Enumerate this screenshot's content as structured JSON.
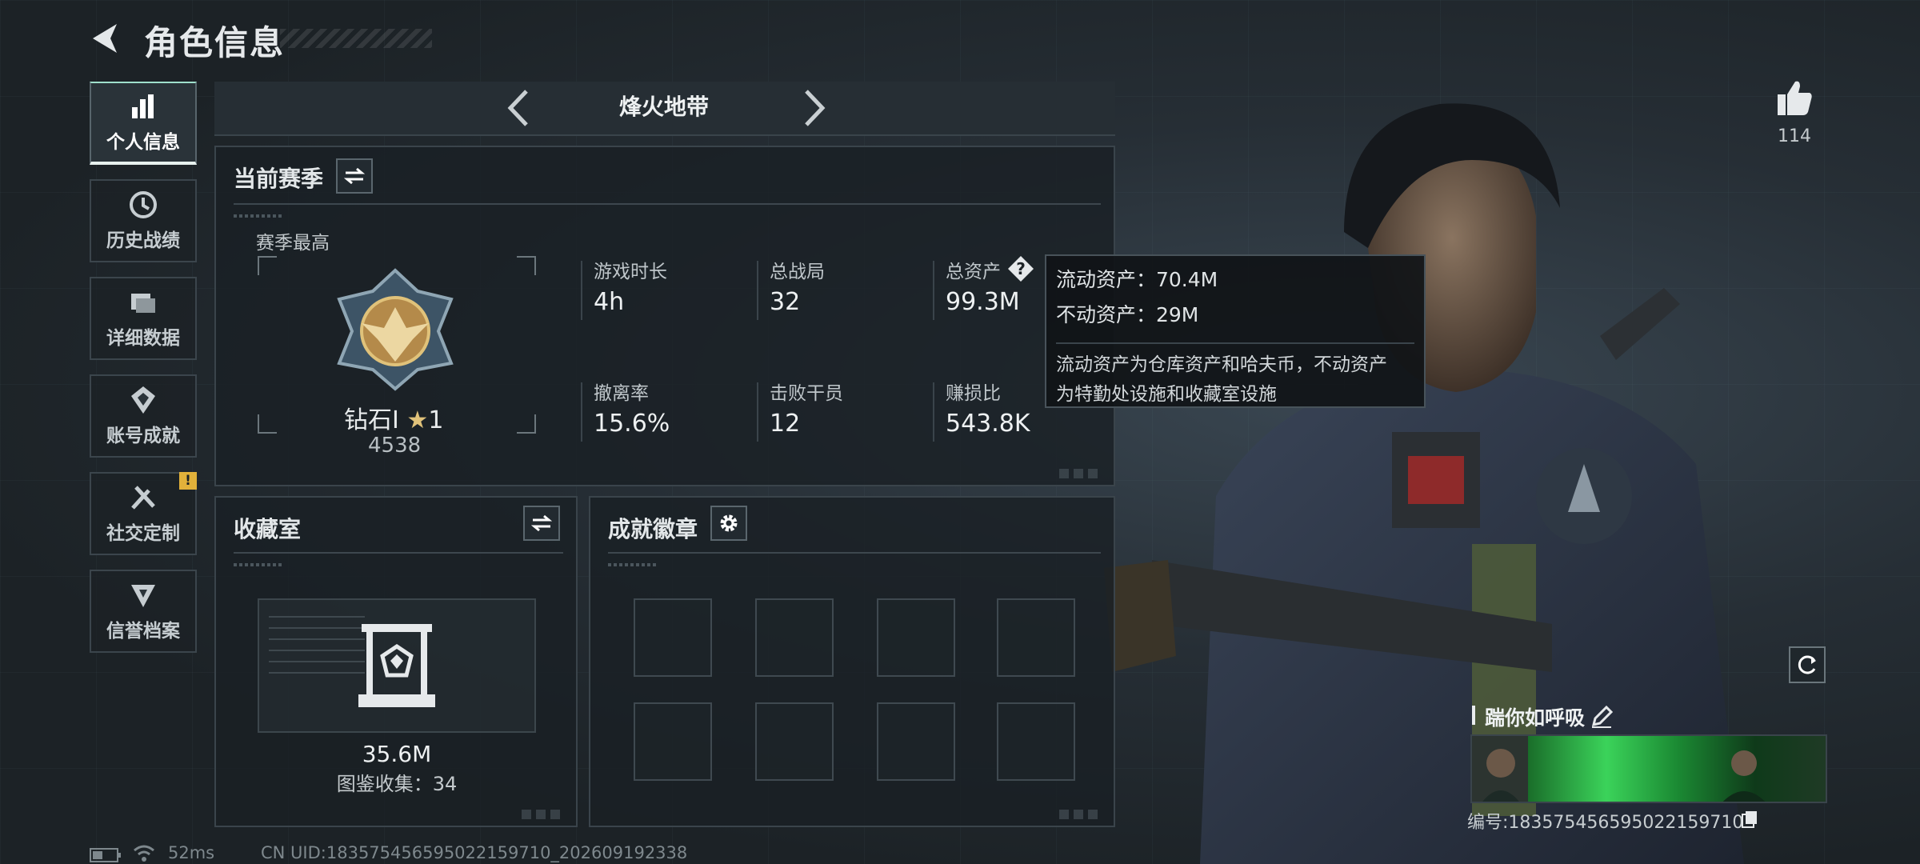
{
  "header": {
    "title": "角色信息"
  },
  "nav": {
    "items": [
      {
        "label": "个人信息",
        "icon": "bar-chart-icon",
        "active": true
      },
      {
        "label": "历史战绩",
        "icon": "clock-icon"
      },
      {
        "label": "详细数据",
        "icon": "folder-icon"
      },
      {
        "label": "账号成就",
        "icon": "achievement-icon"
      },
      {
        "label": "社交定制",
        "icon": "tools-icon",
        "badge": "!"
      },
      {
        "label": "信誉档案",
        "icon": "shield-icon"
      }
    ]
  },
  "mode": {
    "name": "烽火地带"
  },
  "season": {
    "title": "当前赛季",
    "best_label": "赛季最高",
    "rank_name": "钻石Ⅰ",
    "rank_stars": "1",
    "rank_score": "4538",
    "stats": [
      {
        "label": "游戏时长",
        "value": "4h"
      },
      {
        "label": "总战局",
        "value": "32"
      },
      {
        "label": "总资产",
        "value": "99.3M"
      },
      {
        "label": "撤离率",
        "value": "15.6%"
      },
      {
        "label": "击败干员",
        "value": "12"
      },
      {
        "label": "赚损比",
        "value": "543.8K"
      }
    ]
  },
  "tooltip": {
    "liquid": "流动资产：70.4M",
    "fixed": "不动资产：29M",
    "desc_line1": "流动资产为仓库资产和哈夫币，不动资产",
    "desc_line2": "为特勤处设施和收藏室设施"
  },
  "collection": {
    "title": "收藏室",
    "value": "35.6M",
    "count": "图鉴收集：34"
  },
  "badges": {
    "title": "成就徽章",
    "slots": 8
  },
  "player": {
    "likes": "114",
    "name": "踹你如呼吸",
    "id": "编号:183575456595022159710"
  },
  "status": {
    "ping": "52ms",
    "uid": "CN UID:183575456595022159710_202609192338"
  },
  "colors": {
    "accent": "#9fe0cc",
    "warning": "#e2b13a",
    "card_green": "#3bd35a",
    "panel_border": "#3a444b"
  }
}
